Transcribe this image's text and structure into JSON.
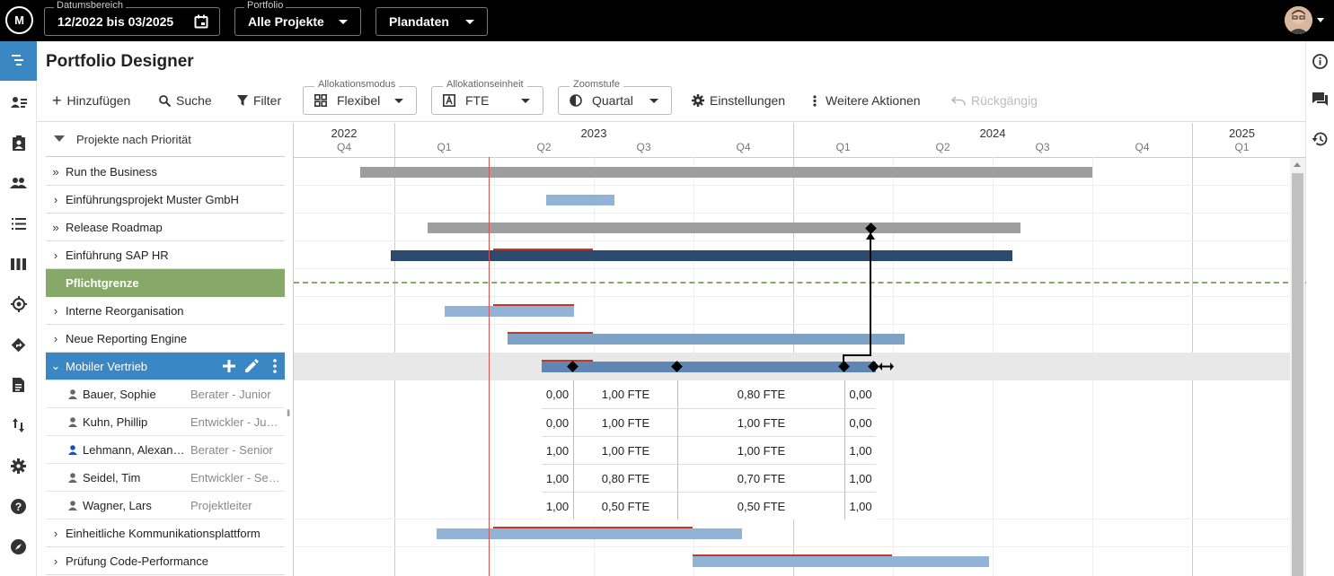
{
  "topbar": {
    "logo": "M",
    "date_range": {
      "label": "Datumsbereich",
      "value": "12/2022 bis 03/2025"
    },
    "portfolio": {
      "label": "Portfolio",
      "value": "Alle Projekte"
    },
    "data_mode": {
      "value": "Plandaten"
    }
  },
  "page_title": "Portfolio Designer",
  "toolbar": {
    "add": "Hinzufügen",
    "search": "Suche",
    "filter": "Filter",
    "allocation_mode": {
      "label": "Allokationsmodus",
      "value": "Flexibel"
    },
    "allocation_unit": {
      "label": "Allokationseinheit",
      "value": "FTE"
    },
    "zoom": {
      "label": "Zoomstufe",
      "value": "Quartal"
    },
    "settings": "Einstellungen",
    "more": "Weitere Aktionen",
    "undo": "Rückgängig"
  },
  "list_header": "Projekte nach Priorität",
  "projects": [
    {
      "label": "Run the Business",
      "chev": "»"
    },
    {
      "label": "Einführungsprojekt Muster GmbH",
      "chev": "›"
    },
    {
      "label": "Release Roadmap",
      "chev": "»"
    },
    {
      "label": "Einführung SAP HR",
      "chev": "›"
    },
    {
      "label": "Pflichtgrenze",
      "chev": ""
    },
    {
      "label": "Interne Reorganisation",
      "chev": "›"
    },
    {
      "label": "Neue Reporting Engine",
      "chev": "›"
    },
    {
      "label": "Mobiler Vertrieb",
      "chev": "⌄"
    }
  ],
  "members": [
    {
      "name": "Bauer, Sophie",
      "role": "Berater - Junior",
      "alloc": [
        "0,00",
        "1,00 FTE",
        "0,80 FTE",
        "0,00"
      ]
    },
    {
      "name": "Kuhn, Phillip",
      "role": "Entwickler - Junior",
      "alloc": [
        "0,00",
        "1,00 FTE",
        "1,00 FTE",
        "0,00"
      ]
    },
    {
      "name": "Lehmann, Alexander",
      "role": "Berater - Senior",
      "alloc": [
        "1,00",
        "1,00 FTE",
        "1,00 FTE",
        "1,00"
      ]
    },
    {
      "name": "Seidel, Tim",
      "role": "Entwickler - Senior",
      "alloc": [
        "1,00",
        "0,80 FTE",
        "0,70 FTE",
        "1,00"
      ]
    },
    {
      "name": "Wagner, Lars",
      "role": "Projektleiter",
      "alloc": [
        "1,00",
        "0,50 FTE",
        "0,50 FTE",
        "1,00"
      ]
    }
  ],
  "projects_after": [
    {
      "label": "Einheitliche Kommunikationsplattform",
      "chev": "›"
    },
    {
      "label": "Prüfung Code-Performance",
      "chev": "›"
    }
  ],
  "timeline": {
    "years": [
      "2022",
      "2023",
      "2024",
      "2025"
    ],
    "quarters": [
      "Q4",
      "Q1",
      "Q2",
      "Q3",
      "Q4",
      "Q1",
      "Q2",
      "Q3",
      "Q4",
      "Q1"
    ]
  },
  "colors": {
    "selected": "#3a87c4",
    "mandatory": "#86a96a",
    "bar_light": "#93b3d6",
    "bar_dark": "#2c4a6e",
    "bar_gray": "#9e9e9e"
  }
}
